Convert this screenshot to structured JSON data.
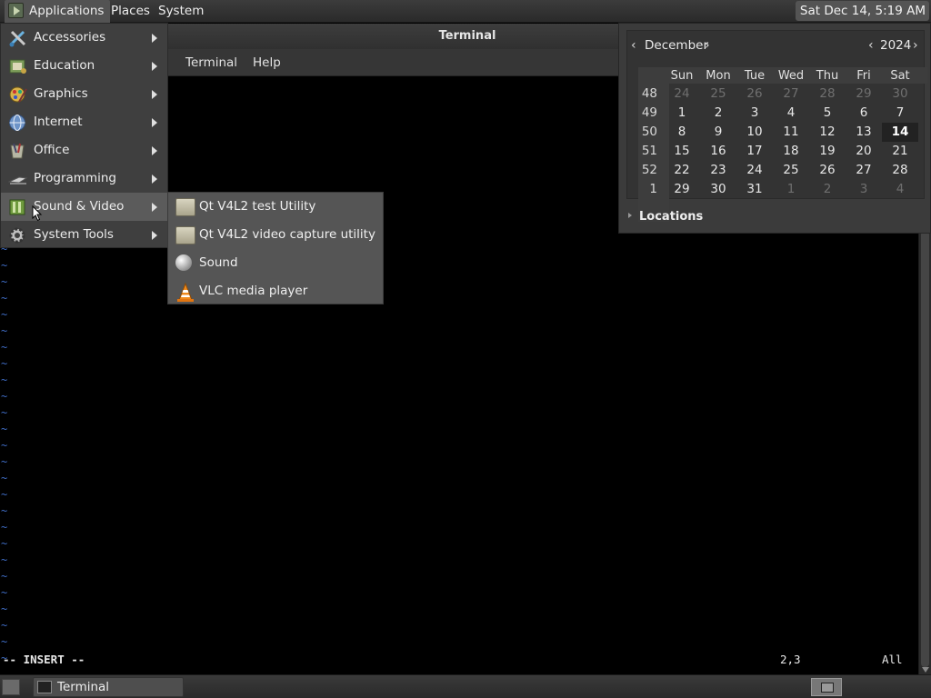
{
  "top_panel": {
    "applications_label": "Applications",
    "places_label": "Places",
    "system_label": "System",
    "clock": "Sat Dec 14,  5:19 AM"
  },
  "terminal": {
    "title": "Terminal",
    "menu": [
      "Terminal",
      "Help"
    ],
    "tilde": "~",
    "vim_status": "-- INSERT --",
    "vim_position": "2,3",
    "vim_scroll": "All"
  },
  "apps_menu": {
    "items": [
      {
        "label": "Accessories",
        "icon": "accessories-icon"
      },
      {
        "label": "Education",
        "icon": "education-icon"
      },
      {
        "label": "Graphics",
        "icon": "graphics-icon"
      },
      {
        "label": "Internet",
        "icon": "internet-icon"
      },
      {
        "label": "Office",
        "icon": "office-icon"
      },
      {
        "label": "Programming",
        "icon": "programming-icon"
      },
      {
        "label": "Sound & Video",
        "icon": "sound-video-icon"
      },
      {
        "label": "System Tools",
        "icon": "system-tools-icon"
      }
    ],
    "active": "Sound & Video"
  },
  "sound_video_submenu": {
    "items": [
      {
        "label": "Qt V4L2 test Utility",
        "icon": "folder-icon"
      },
      {
        "label": "Qt V4L2 video capture utility",
        "icon": "folder-icon"
      },
      {
        "label": "Sound",
        "icon": "sound-icon"
      },
      {
        "label": "VLC media player",
        "icon": "vlc-cone-icon"
      }
    ]
  },
  "calendar": {
    "month": "December",
    "year": "2024",
    "weekdays": [
      "Sun",
      "Mon",
      "Tue",
      "Wed",
      "Thu",
      "Fri",
      "Sat"
    ],
    "weeks": [
      {
        "num": "48",
        "days": [
          "24",
          "25",
          "26",
          "27",
          "28",
          "29",
          "30"
        ],
        "dim": [
          true,
          true,
          true,
          true,
          true,
          true,
          true
        ]
      },
      {
        "num": "49",
        "days": [
          "1",
          "2",
          "3",
          "4",
          "5",
          "6",
          "7"
        ],
        "dim": [
          false,
          false,
          false,
          false,
          false,
          false,
          false
        ]
      },
      {
        "num": "50",
        "days": [
          "8",
          "9",
          "10",
          "11",
          "12",
          "13",
          "14"
        ],
        "dim": [
          false,
          false,
          false,
          false,
          false,
          false,
          false
        ]
      },
      {
        "num": "51",
        "days": [
          "15",
          "16",
          "17",
          "18",
          "19",
          "20",
          "21"
        ],
        "dim": [
          false,
          false,
          false,
          false,
          false,
          false,
          false
        ]
      },
      {
        "num": "52",
        "days": [
          "22",
          "23",
          "24",
          "25",
          "26",
          "27",
          "28"
        ],
        "dim": [
          false,
          false,
          false,
          false,
          false,
          false,
          false
        ]
      },
      {
        "num": "1",
        "days": [
          "29",
          "30",
          "31",
          "1",
          "2",
          "3",
          "4"
        ],
        "dim": [
          false,
          false,
          false,
          true,
          true,
          true,
          true
        ]
      }
    ],
    "today": "14",
    "locations_label": "Locations"
  },
  "bottom_panel": {
    "taskbar_terminal_label": "Terminal"
  },
  "colors": {
    "panel_bg": "#2f2f2f",
    "menu_bg": "#3f3f3f",
    "menu_active": "#5b5b5b",
    "submenu_bg": "#555555",
    "vim_tilde": "#3f6cc4"
  }
}
